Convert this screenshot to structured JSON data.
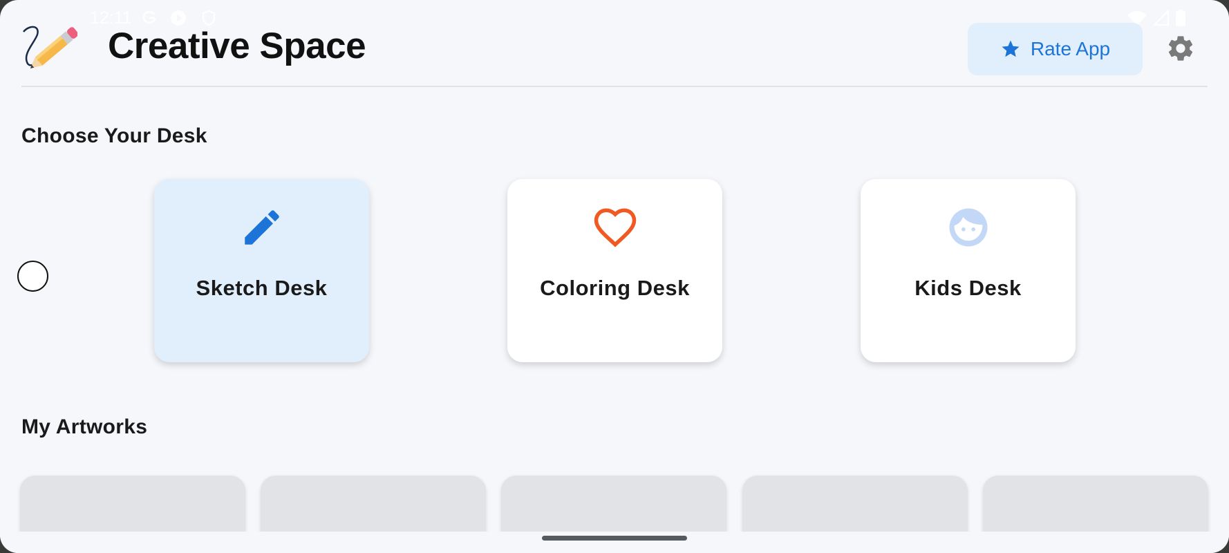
{
  "status_bar": {
    "time": "12:11",
    "icons": [
      "google-g-icon",
      "play-circle-icon",
      "shield-icon",
      "wifi-icon",
      "signal-icon",
      "battery-icon"
    ]
  },
  "header": {
    "app_title": "Creative Space",
    "logo_icon": "pencil-scribble-logo",
    "rate_button": {
      "label": "Rate App",
      "icon": "star-icon"
    },
    "settings_icon": "gear-icon"
  },
  "sections": {
    "desks_title": "Choose Your Desk",
    "artworks_title": "My Artworks"
  },
  "desks": [
    {
      "label": "Sketch Desk",
      "icon": "pencil-icon",
      "selected": true,
      "color": "#1d74d8"
    },
    {
      "label": "Coloring Desk",
      "icon": "heart-outline-icon",
      "selected": false,
      "color": "#f05a22"
    },
    {
      "label": "Kids Desk",
      "icon": "child-face-icon",
      "selected": false,
      "color": "#c3d7f7"
    }
  ],
  "artworks_count": 5,
  "colors": {
    "background": "#f5f7fb",
    "accent": "#1d74d8",
    "selected_card": "#e1eefb",
    "placeholder_card": "#e2e3e7"
  }
}
